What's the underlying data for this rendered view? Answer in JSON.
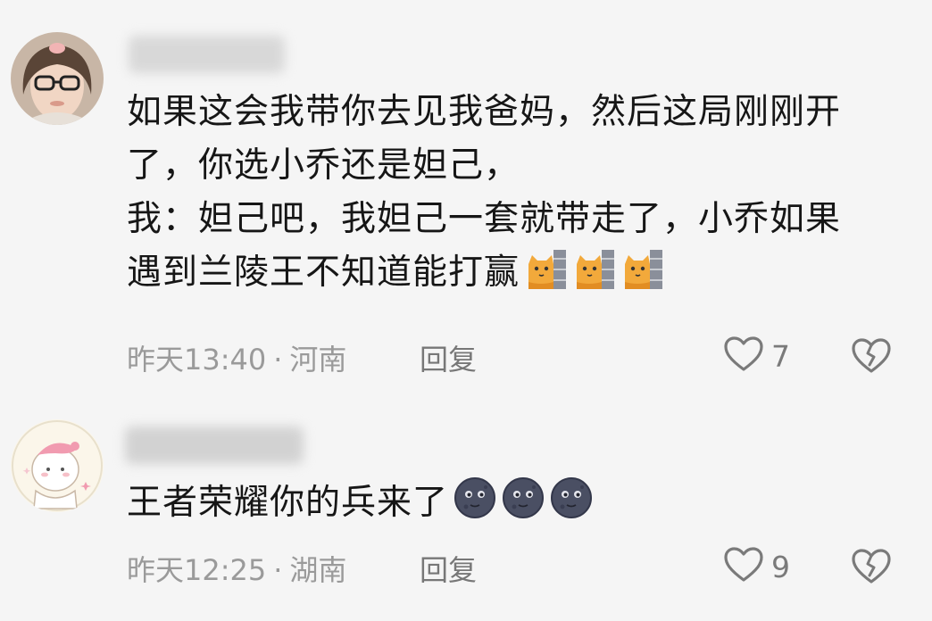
{
  "comments": [
    {
      "text_lines": [
        "如果这会我带你去见我爸妈，然后这局刚刚开",
        "了，你选小乔还是妲己，",
        "我：妲己吧，我妲己一套就带走了，小乔如果",
        "遇到兰陵王不知道能打赢"
      ],
      "emoji_icon": "cat-peeking-wall-emoji",
      "emoji_count": 3,
      "time": "昨天13:40",
      "separator": "·",
      "location": "河南",
      "reply_label": "回复",
      "likes": "7"
    },
    {
      "text_lines": [
        "王者荣耀你的兵来了"
      ],
      "emoji_icon": "new-moon-face-emoji",
      "emoji_count": 3,
      "time": "昨天12:25",
      "separator": "·",
      "location": "湖南",
      "reply_label": "回复",
      "likes": "9"
    }
  ],
  "colors": {
    "background": "#f5f5f5",
    "text": "#161616",
    "meta": "#9a9a9a",
    "icon": "#7a7a7a"
  }
}
